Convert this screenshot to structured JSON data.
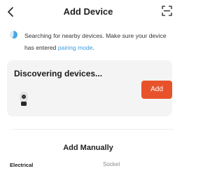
{
  "header": {
    "title": "Add Device",
    "back_icon": "chevron-left-icon",
    "scan_icon": "scan-icon"
  },
  "search": {
    "text_before": "Searching for nearby devices. Make sure your device has entered ",
    "link": "pairing mode",
    "text_after": ".",
    "spinner_color": "#4aa8e0",
    "link_color": "#3a9be0"
  },
  "discover": {
    "title": "Discovering devices...",
    "add_label": "Add",
    "device_icon": "camera-device-icon",
    "add_color": "#e8522a"
  },
  "manual": {
    "title": "Add Manually",
    "categories": [
      "Electrical",
      "Socket"
    ]
  }
}
